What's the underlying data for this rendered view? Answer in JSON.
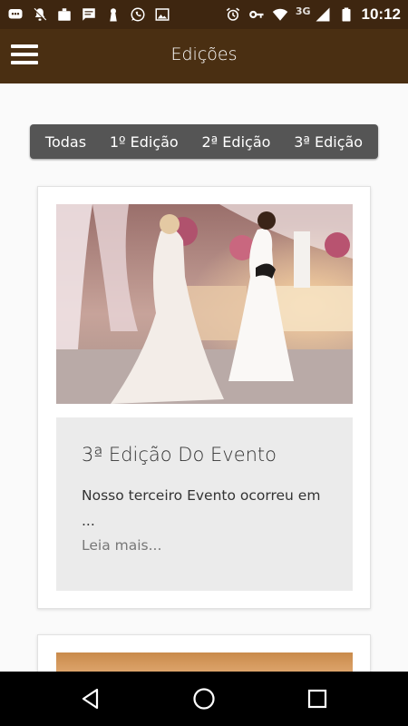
{
  "status_bar": {
    "time": "10:12",
    "network": "3G",
    "icons": [
      "chat-icon",
      "mute-icon",
      "store-icon",
      "message-icon",
      "keyhole-icon",
      "whatsapp-icon",
      "image-icon",
      "alarm-icon",
      "key-icon",
      "wifi-icon",
      "signal-icon",
      "battery-icon"
    ]
  },
  "app_bar": {
    "title": "Edições",
    "menu_icon": "hamburger-menu-icon"
  },
  "filters": {
    "items": [
      {
        "label": "Todas"
      },
      {
        "label": "1º Edição"
      },
      {
        "label": "2ª Edição"
      },
      {
        "label": "3ª Edição"
      }
    ]
  },
  "posts": [
    {
      "image": "brides-wedding-dresses-photo",
      "title": "3ª Edição Do Evento",
      "excerpt": "Nosso terceiro Evento ocorreu em ...",
      "read_more": "Leia mais..."
    },
    {
      "image": "event-venue-photo"
    }
  ],
  "nav_bar": {
    "buttons": [
      "back-icon",
      "home-icon",
      "recents-icon"
    ]
  },
  "colors": {
    "status_bar": "#3e2610",
    "app_bar": "#4a2f12",
    "filter_bar": "#555555",
    "card_body": "#ebebeb"
  }
}
